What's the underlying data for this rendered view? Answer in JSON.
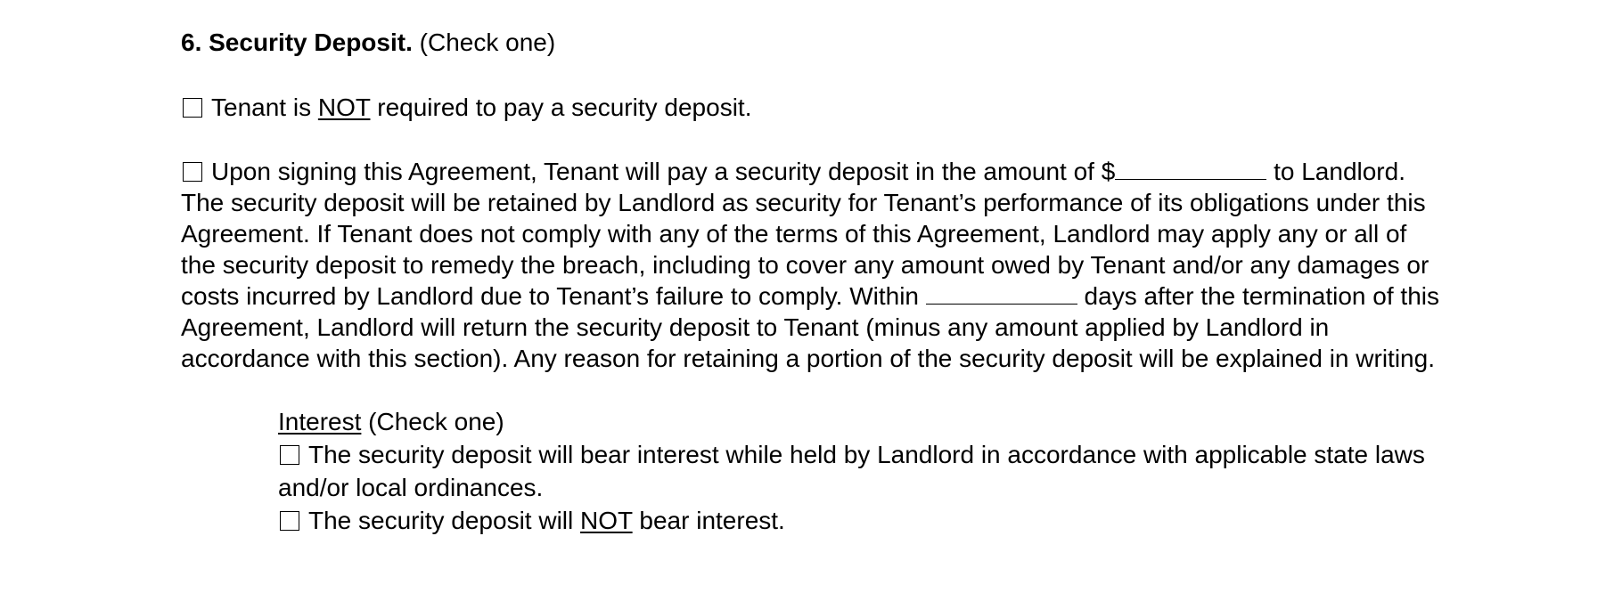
{
  "section": {
    "number_title": "6. Security Deposit.",
    "instruction": "(Check one)"
  },
  "option_no_deposit": {
    "prefix": "Tenant is ",
    "emphasis": "NOT",
    "suffix": " required to pay a security deposit."
  },
  "option_deposit": {
    "text_before_amount": "Upon signing this Agreement, Tenant will pay a security deposit in the amount of $",
    "text_after_amount": " to Landlord. The security deposit will be retained by Landlord as security for Tenant’s performance of its obligations under this Agreement. If Tenant does not comply with any of the terms of this Agreement, Landlord may apply any or all of the security deposit to remedy the breach, including to cover any amount owed by Tenant and/or any damages or costs incurred by Landlord due to Tenant’s failure to comply. Within ",
    "text_after_days": " days after the termination of this Agreement, Landlord will return the security deposit to Tenant (minus any amount applied by Landlord in accordance with this section). Any reason for retaining a portion of the security deposit will be explained in writing."
  },
  "interest": {
    "title": "Interest",
    "instruction": " (Check one)",
    "option_bear": "The security deposit will bear interest while held by Landlord in accordance with applicable state laws and/or local ordinances.",
    "option_not_prefix": "The security deposit will ",
    "option_not_emphasis": "NOT",
    "option_not_suffix": " bear interest."
  }
}
